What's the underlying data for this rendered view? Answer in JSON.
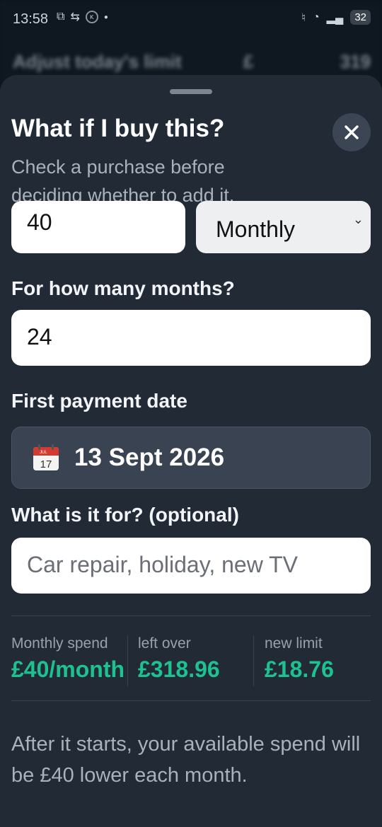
{
  "status_bar": {
    "time": "13:58",
    "battery": "32"
  },
  "background": {
    "row_label": "Adjust today's limit",
    "currency": "£",
    "value": "319"
  },
  "sheet": {
    "title": "What if I buy this?",
    "subtitle": "Check a purchase before deciding whether to add it.",
    "amount_value": "40",
    "frequency_selected": "Monthly",
    "months_label": "For how many months?",
    "months_value": "24",
    "date_label": "First payment date",
    "date_value": "13 Sept 2026",
    "calendar_icon_month": "JUL",
    "calendar_icon_day": "17",
    "purpose_label": "What is it for? (optional)",
    "purpose_placeholder": "Car repair, holiday, new TV",
    "stats": [
      {
        "label": "Monthly spend",
        "value": "£40/month"
      },
      {
        "label": "left over",
        "value": "£318.96"
      },
      {
        "label": "new limit",
        "value": "£18.76"
      }
    ],
    "footnote": "After it starts, your available spend will be £40 lower each month."
  },
  "colors": {
    "accent": "#1ec290",
    "sheet_bg": "#222a36"
  }
}
